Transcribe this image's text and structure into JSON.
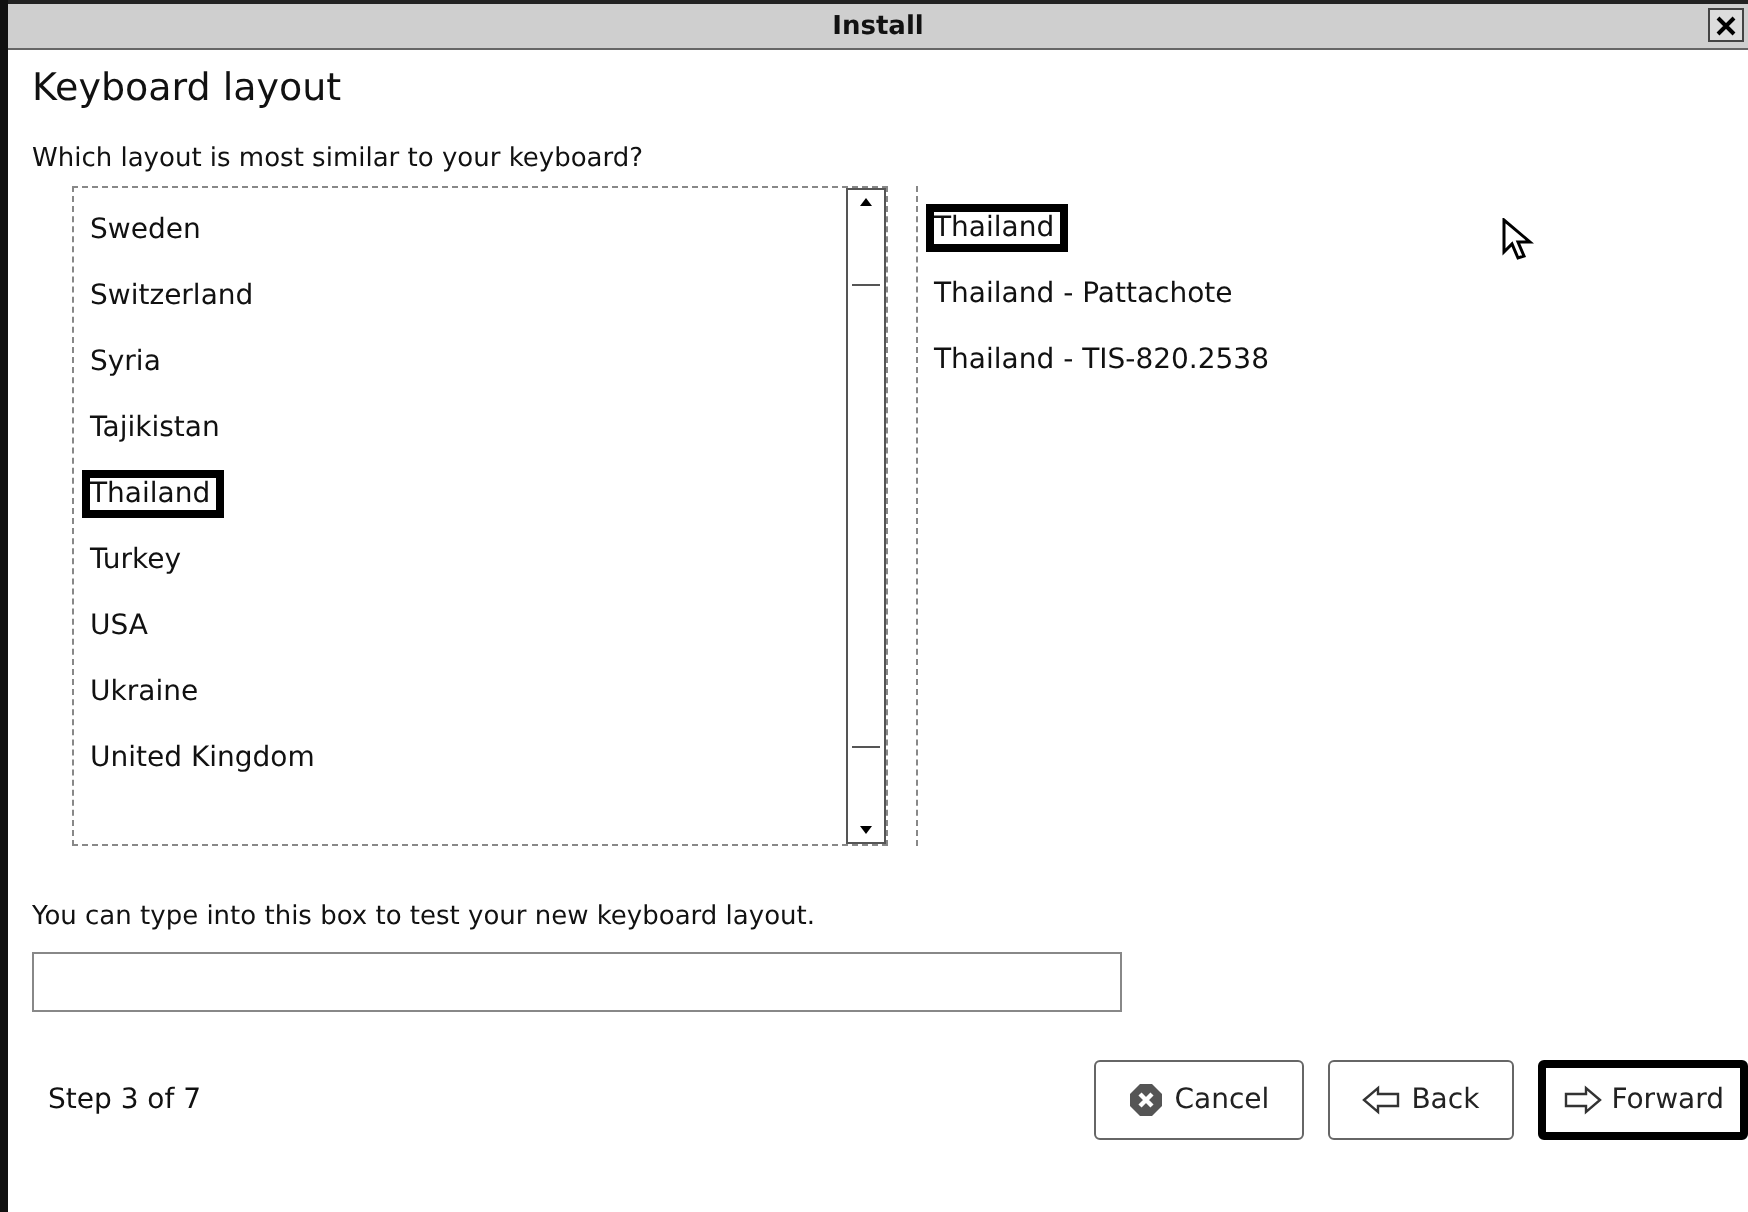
{
  "window": {
    "title": "Install"
  },
  "heading": "Keyboard layout",
  "question": "Which layout is most similar to your keyboard?",
  "countries": [
    {
      "label": "Sweden",
      "selected": false
    },
    {
      "label": "Switzerland",
      "selected": false
    },
    {
      "label": "Syria",
      "selected": false
    },
    {
      "label": "Tajikistan",
      "selected": false
    },
    {
      "label": "Thailand",
      "selected": true
    },
    {
      "label": "Turkey",
      "selected": false
    },
    {
      "label": "USA",
      "selected": false
    },
    {
      "label": "Ukraine",
      "selected": false
    },
    {
      "label": "United Kingdom",
      "selected": false
    }
  ],
  "variants": [
    {
      "label": "Thailand",
      "selected": true
    },
    {
      "label": "Thailand - Pattachote",
      "selected": false
    },
    {
      "label": "Thailand - TIS-820.2538",
      "selected": false
    }
  ],
  "test_prompt": "You can type into this box to test your new keyboard layout.",
  "step": "Step 3 of 7",
  "buttons": [
    {
      "kind": "cancel",
      "label": "Cancel",
      "selected": false
    },
    {
      "kind": "back",
      "label": "Back",
      "selected": false
    },
    {
      "kind": "forward",
      "label": "Forward",
      "selected": true
    }
  ]
}
